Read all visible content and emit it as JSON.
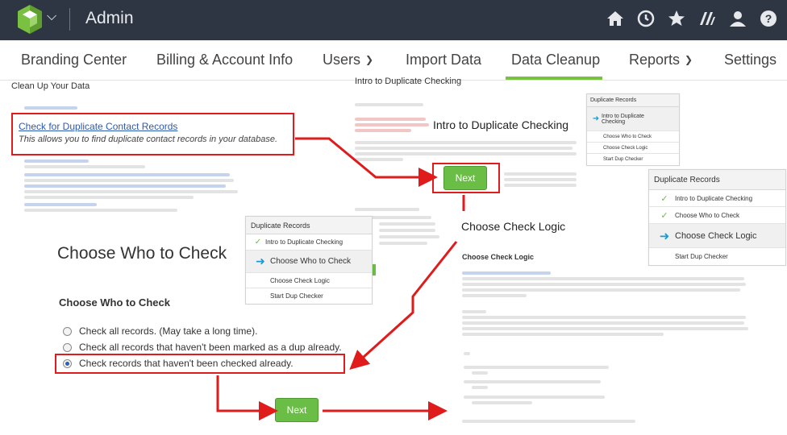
{
  "header": {
    "app_title": "Admin",
    "icons": [
      "home-icon",
      "clock-icon",
      "star-icon",
      "apps-icon",
      "user-icon",
      "help-icon"
    ]
  },
  "nav": {
    "items": [
      {
        "label": "Branding Center",
        "dropdown": false
      },
      {
        "label": "Billing & Account Info",
        "dropdown": false
      },
      {
        "label": "Users",
        "dropdown": true
      },
      {
        "label": "Import Data",
        "dropdown": false
      },
      {
        "label": "Data Cleanup",
        "dropdown": false,
        "active": true
      },
      {
        "label": "Reports",
        "dropdown": true
      },
      {
        "label": "Settings",
        "dropdown": false
      }
    ]
  },
  "cleanup": {
    "title": "Clean Up Your Data",
    "link": "Check for Duplicate Contact Records",
    "link_desc": "This allows you to find duplicate contact records in your database."
  },
  "intro": {
    "panel_title": "Intro to Duplicate Checking",
    "heading": "Intro to Duplicate Checking",
    "next_label": "Next"
  },
  "widget_small": {
    "title": "Duplicate Records",
    "steps": [
      "Intro to Duplicate Checking",
      "Choose Who to Check",
      "Choose Check Logic",
      "Start Dup Checker"
    ]
  },
  "widget_who": {
    "title": "Duplicate Records",
    "steps": [
      "Intro to Duplicate Checking",
      "Choose Who to Check",
      "Choose Check Logic",
      "Start Dup Checker"
    ]
  },
  "widget_logic": {
    "title": "Duplicate Records",
    "steps": [
      "Intro to Duplicate Checking",
      "Choose Who to Check",
      "Choose Check Logic",
      "Start Dup Checker"
    ]
  },
  "who": {
    "big_title": "Choose Who to Check",
    "sub_title": "Choose Who to Check",
    "options": [
      "Check all records. (May take a long time).",
      "Check all records that haven't been marked as a dup already.",
      "Check records that haven't been checked already."
    ],
    "next_label": "Next"
  },
  "logic": {
    "heading": "Choose Check Logic",
    "sub_title": "Choose Check Logic"
  },
  "colors": {
    "topbar": "#2f3643",
    "accent_green": "#7ac142",
    "callout_red": "#e01b1b",
    "link_blue": "#2c5ab0",
    "step_arrow": "#1a9bd1"
  }
}
